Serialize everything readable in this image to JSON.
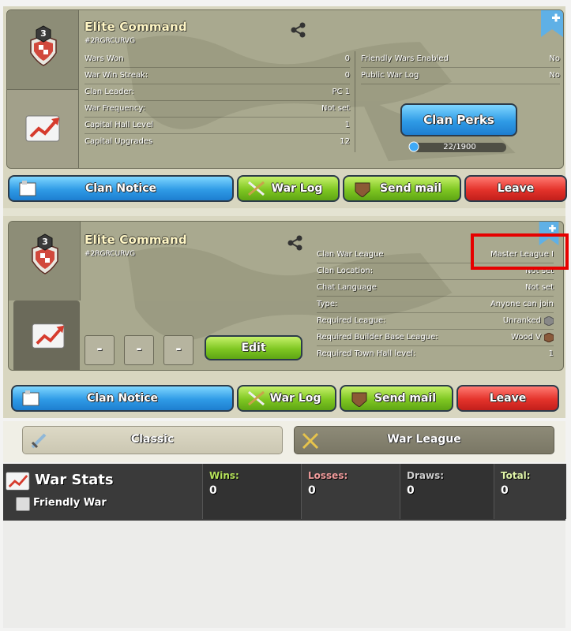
{
  "colors": {
    "accent_yellow": "#fff6c5",
    "wins": "#b6e35a",
    "losses": "#f29c9c",
    "draws": "#cfcfcf",
    "total": "#e0f4a8",
    "highlight": "#e60000"
  },
  "panel1": {
    "clan_name": "Elite Command",
    "clan_tag": "#2RGRCURVG",
    "clan_level": "3",
    "left_rows": [
      {
        "key": "Wars Won",
        "value": "0"
      },
      {
        "key": "War Win Streak:",
        "value": "0"
      },
      {
        "key": "Clan Leader:",
        "value": "PC 1"
      },
      {
        "key": "War Frequency:",
        "value": "Not set"
      },
      {
        "key": "Capital Hall Level",
        "value": "1"
      },
      {
        "key": "Capital Upgrades",
        "value": "12"
      }
    ],
    "right_rows": [
      {
        "key": "Friendly Wars Enabled",
        "value": "No"
      },
      {
        "key": "Public War Log",
        "value": "No"
      }
    ],
    "clan_perks_label": "Clan Perks",
    "xp_progress": "22/1900"
  },
  "panel2": {
    "clan_name": "Elite Command",
    "clan_tag": "#2RGRCURVG",
    "clan_level": "3",
    "rows": [
      {
        "key": "Clan War League",
        "value": "Master League I"
      },
      {
        "key": "Clan Location:",
        "value": "Not set"
      },
      {
        "key": "Chat Language",
        "value": "Not set"
      },
      {
        "key": "Type:",
        "value": "Anyone can join"
      },
      {
        "key": "Required League:",
        "value": "Unranked"
      },
      {
        "key": "Required Builder Base League:",
        "value": "Wood V"
      },
      {
        "key": "Required Town Hall level:",
        "value": "1"
      }
    ],
    "dash1": "-",
    "dash2": "-",
    "dash3": "-",
    "edit_label": "Edit"
  },
  "buttons": {
    "clan_notice": "Clan Notice",
    "war_log": "War Log",
    "send_mail": "Send mail",
    "leave": "Leave"
  },
  "tabs": {
    "classic": "Classic",
    "war_league": "War League"
  },
  "stats": {
    "title": "War Stats",
    "friendly_war": "Friendly War",
    "wins_label": "Wins:",
    "wins_value": "0",
    "losses_label": "Losses:",
    "losses_value": "0",
    "draws_label": "Draws:",
    "draws_value": "0",
    "total_label": "Total:",
    "total_value": "0"
  }
}
